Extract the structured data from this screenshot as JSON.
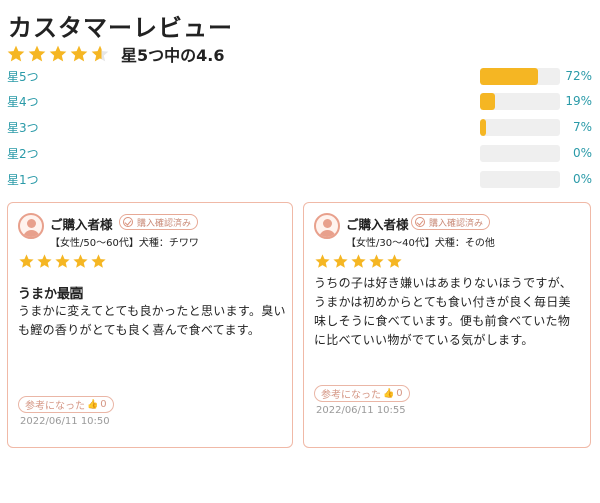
{
  "header": {
    "title": "カスタマーレビュー"
  },
  "summary": {
    "rating": 4.6,
    "text": "星5つ中の4.6"
  },
  "distribution": [
    {
      "label": "星5つ",
      "percent": 72,
      "percent_text": "72%"
    },
    {
      "label": "星4つ",
      "percent": 19,
      "percent_text": "19%"
    },
    {
      "label": "星3つ",
      "percent": 7,
      "percent_text": "7%"
    },
    {
      "label": "星2つ",
      "percent": 0,
      "percent_text": "0%"
    },
    {
      "label": "星1つ",
      "percent": 0,
      "percent_text": "0%"
    }
  ],
  "colors": {
    "star": "#f5b623",
    "accent": "#2a9aa8",
    "border": "#f0b9a7",
    "track": "#efefef"
  },
  "reviews": [
    {
      "reviewer": "ご購入者様",
      "verified": "購入確認済み",
      "meta": "【女性/50〜60代】犬種：チワワ",
      "rating": 5,
      "title": "うまか最高⃞",
      "body": "うまかに変えてとても良かったと思います。臭いも鰹の香りがとても良く喜んで食べてます。",
      "helpful_label": "参考になった",
      "helpful_count": "0",
      "date": "2022/06/11 10:50"
    },
    {
      "reviewer": "ご購入者様",
      "verified": "購入確認済み",
      "meta": "【女性/30〜40代】犬種：その他",
      "rating": 5,
      "title": "",
      "body": "うちの子は好き嫌いはあまりないほうですが、うまかは初めからとても食い付きが良く毎日美味しそうに食べています。便も前食べていた物に比べていい物がでている気がします。",
      "helpful_label": "参考になった",
      "helpful_count": "0",
      "date": "2022/06/11 10:55"
    }
  ]
}
